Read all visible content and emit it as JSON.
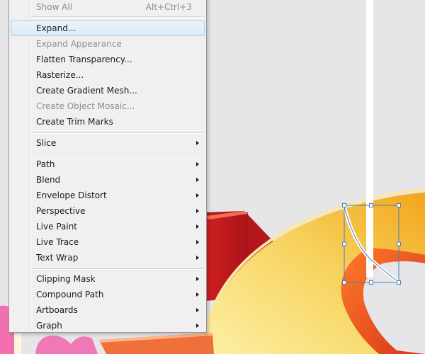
{
  "menu": {
    "items": [
      {
        "label": "Show All",
        "shortcut": "Alt+Ctrl+3",
        "disabled": true
      },
      {
        "label": "Expand...",
        "highlight": true
      },
      {
        "label": "Expand Appearance",
        "disabled": true
      },
      {
        "label": "Flatten Transparency..."
      },
      {
        "label": "Rasterize..."
      },
      {
        "label": "Create Gradient Mesh..."
      },
      {
        "label": "Create Object Mosaic...",
        "disabled": true
      },
      {
        "label": "Create Trim Marks"
      },
      {
        "label": "Slice",
        "submenu": true
      },
      {
        "label": "Path",
        "submenu": true
      },
      {
        "label": "Blend",
        "submenu": true
      },
      {
        "label": "Envelope Distort",
        "submenu": true
      },
      {
        "label": "Perspective",
        "submenu": true
      },
      {
        "label": "Live Paint",
        "submenu": true
      },
      {
        "label": "Live Trace",
        "submenu": true
      },
      {
        "label": "Text Wrap",
        "submenu": true
      },
      {
        "label": "Clipping Mask",
        "submenu": true
      },
      {
        "label": "Compound Path",
        "submenu": true
      },
      {
        "label": "Artboards",
        "submenu": true
      },
      {
        "label": "Graph",
        "submenu": true
      }
    ]
  },
  "colors": {
    "canvas": "#e6e6e8",
    "menu_bg": "#f0f0f0",
    "highlight": "#d9ecf8",
    "disabled_text": "#8d8d8d",
    "selection": "#4a7ec2"
  }
}
